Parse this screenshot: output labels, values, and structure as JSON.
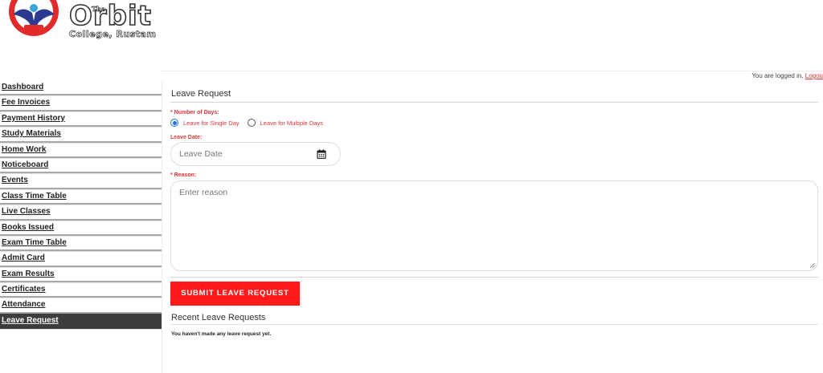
{
  "header": {
    "logo_the": "The",
    "logo_name": "Orbit",
    "logo_subtitle": "College, Rustam",
    "emblem_text": "Rustam"
  },
  "status": {
    "logged_in_text": "You are logged in.",
    "logout_label": "Logou"
  },
  "sidebar": {
    "items": [
      {
        "label": "Dashboard",
        "active": false
      },
      {
        "label": "Fee Invoices",
        "active": false
      },
      {
        "label": "Payment History",
        "active": false
      },
      {
        "label": "Study Materials",
        "active": false
      },
      {
        "label": "Home Work",
        "active": false
      },
      {
        "label": "Noticeboard",
        "active": false
      },
      {
        "label": "Events",
        "active": false
      },
      {
        "label": "Class Time Table",
        "active": false
      },
      {
        "label": "Live Classes",
        "active": false
      },
      {
        "label": "Books Issued",
        "active": false
      },
      {
        "label": "Exam Time Table",
        "active": false
      },
      {
        "label": "Admit Card",
        "active": false
      },
      {
        "label": "Exam Results",
        "active": false
      },
      {
        "label": "Certificates",
        "active": false
      },
      {
        "label": "Attendance",
        "active": false
      },
      {
        "label": "Leave Request",
        "active": true
      }
    ]
  },
  "form": {
    "title": "Leave Request",
    "days_label": "* Number of Days:",
    "options": [
      {
        "label": "Leave for Single Day",
        "checked": true
      },
      {
        "label": "Leave for Multiple Days",
        "checked": false
      }
    ],
    "date_label": "Leave Date:",
    "date_placeholder": "Leave Date",
    "reason_label": "* Reason:",
    "reason_placeholder": "Enter reason",
    "submit_label": "SUBMIT LEAVE REQUEST"
  },
  "recent": {
    "title": "Recent Leave Requests",
    "empty_message": "You haven't made any leave request yet."
  },
  "colors": {
    "accent_red": "#ff1b1b",
    "label_red": "#e0353b",
    "active_nav_bg": "#3d3d3d",
    "radio_blue": "#1a73e8"
  }
}
